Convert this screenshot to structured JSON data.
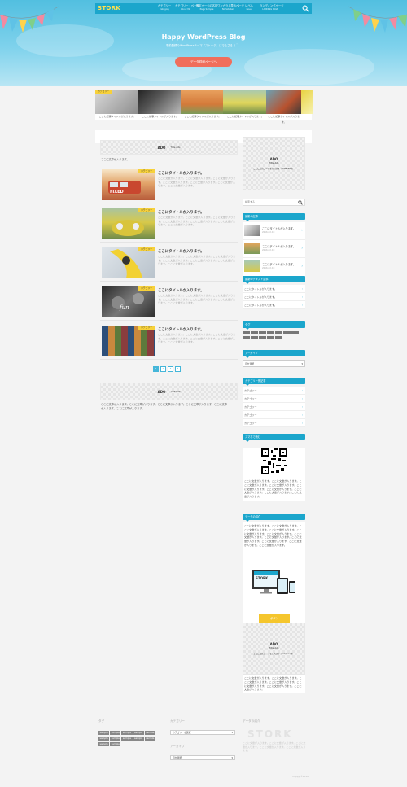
{
  "header": {
    "logo": "STORK",
    "nav": [
      {
        "label": "カテゴリー",
        "sub": "Category"
      },
      {
        "label": "カテゴリー・ページ",
        "sub": "About Me"
      },
      {
        "label": "固定ページの名前",
        "sub": "Page Sample"
      },
      {
        "label": "ワンカラム表示ページ",
        "sub": "No Sidebar"
      },
      {
        "label": "レベル",
        "sub": "Level"
      },
      {
        "label": "ランディングページ",
        "sub": "LANDING PAGE"
      }
    ],
    "site_title": "Happy WordPress Blog",
    "site_desc": "事前登録のWordPressテーマ「ストーク」にでもさる（＾）",
    "hero_button": "データ詳細ページへ"
  },
  "slider": {
    "cat_label": "カテゴリー",
    "caption": "ここに記事タイトルが入ります。"
  },
  "main": {
    "ad": {
      "label": "ADO",
      "sub": "Title Ads",
      "text": "ここに文章が入ります。"
    },
    "articles": [
      {
        "category": "カテゴリー",
        "title": "ここにタイトルが入ります。",
        "excerpt": "ここに文章が入ります。ここに文章が入ります。ここに文章が入ります。ここに文章が入ります。ここに文章が入ります。ここに文章が入ります。ここに文章が入ります。"
      },
      {
        "category": "カテゴリー",
        "title": "ここにタイトルが入ります。",
        "excerpt": "ここに文章が入ります。ここに文章が入ります。ここに文章が入ります。ここに文章が入ります。ここに文章が入ります。ここに文章が入ります。ここに文章が入ります。"
      },
      {
        "category": "カテゴリー",
        "title": "ここにタイトルが入ります。",
        "excerpt": "ここに文章が入ります。ここに文章が入ります。ここに文章が入ります。ここに文章が入ります。ここに文章が入ります。ここに文章が入ります。ここに文章が入ります。"
      },
      {
        "category": "カテゴリー",
        "title": "ここにタイトルが入ります。",
        "excerpt": "ここに文章が入ります。ここに文章が入ります。ここに文章が入ります。ここに文章が入ります。ここに文章が入ります。ここに文章が入ります。ここに文章が入ります。"
      },
      {
        "category": "カテゴリー",
        "title": "ここにタイトルが入ります。",
        "excerpt": "ここに文章が入ります。ここに文章が入ります。ここに文章が入ります。ここに文章が入ります。ここに文章が入ります。ここに文章が入ります。ここに文章が入ります。"
      }
    ],
    "pager": [
      "1",
      "2",
      "3",
      "4"
    ],
    "bottom_ad": {
      "label": "ADO",
      "sub": "Title Ads",
      "text": "ここに文章が入ります。ここに文章が入ります。ここに文章が入ります。ここに文章が入ります。ここに文章が入ります。ここに文章が入ります。"
    }
  },
  "sidebar": {
    "ad_top": {
      "label": "ADO",
      "sub": "Title Ads",
      "note": "ここに広告コードを入れます（Adsense等）"
    },
    "search_placeholder": "検索する",
    "recent_title": "最新の記事",
    "recent_items": [
      "ここにタイトルが入ります。",
      "ここにタイトルが入ります。",
      "ここにタイトルが入ります。"
    ],
    "recent_date": "2016.XX.XX",
    "textlist_title": "最新のテキスト記事",
    "textlist_items": [
      "ここにタイトルが入ります。",
      "ここにタイトルが入ります。",
      "ここにタイトルが入ります。"
    ],
    "tag_title": "タグ",
    "archive_title": "アーカイブ",
    "archive_select": "月を選択",
    "category_title": "カテゴリー別記事",
    "category_items": [
      "カテゴリー",
      "カテゴリー",
      "カテゴリー",
      "カテゴリー",
      "カテゴリー"
    ],
    "phone_title": "スマホで読む",
    "phone_text": "ここに文章が入ります。ここに文章が入ります。ここに文章が入ります。ここに文章が入ります。ここに文章が入ります。ここに文章が入ります。ここに文章が入ります。ここに文章が入ります。ここに文章が入ります。",
    "intro_title": "データの紹介",
    "intro_text": "ここに文章が入ります。ここに文章が入ります。ここに文章が入ります。ここに文章が入ります。ここに文章が入ります。ここに文章が入ります。ここに文章が入ります。ここに文章が入ります。ここに文章が入ります。ここに文章が入ります。ここに文章が入ります。ここに文章が入ります。",
    "intro_button": "ボタン",
    "device_logo": "STORK",
    "ad_bottom": {
      "label": "ADO",
      "sub": "Title Ads",
      "note": "ここに広告コードを入れます（Adsense等）"
    },
    "ad_bottom_text": "ここに文章が入ります。ここに文章が入ります。ここに文章が入ります。ここに文章が入ります。ここに文章が入ります。ここに文章が入ります。ここに文章が入ります。"
  },
  "footer": {
    "tag_title": "タグ",
    "tags": [
      "sample",
      "sample",
      "sample",
      "sample",
      "sample",
      "sample",
      "sample",
      "sample",
      "sample",
      "sample",
      "sample",
      "sample"
    ],
    "category_title": "カテゴリー",
    "category_select": "カテゴリーを選択",
    "archive_title": "アーカイブ",
    "archive_select": "月を選択",
    "about_title": "データの紹介",
    "about_logo": "STORK",
    "about_text": "ここに文章が入ります。ここに文章が入ります。ここに文章が入ります。ここに文章が入ります。ここに文章が入ります。",
    "copyright": "Happy ©2016"
  },
  "colors": {
    "accent": "#1ba6cc",
    "button": "#f06e5c",
    "category": "#f7d13a",
    "intro_button": "#f5c62d"
  }
}
